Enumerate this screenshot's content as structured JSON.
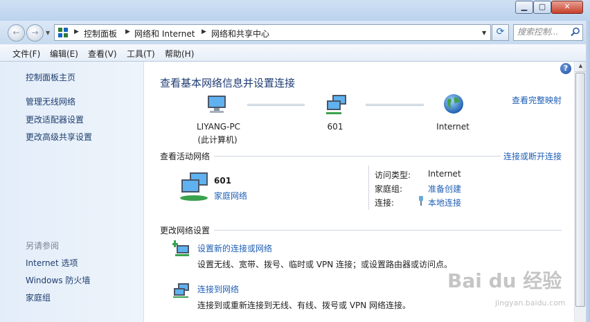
{
  "window": {
    "minimize_glyph": "▁",
    "maximize_glyph": "▢",
    "close_glyph": "✕"
  },
  "nav": {
    "back_glyph": "←",
    "forward_glyph": "→",
    "breadcrumb": [
      "控制面板",
      "网络和 Internet",
      "网络和共享中心"
    ],
    "search_placeholder": "搜索控制...",
    "refresh_glyph": "⟳"
  },
  "menu": [
    "文件(F)",
    "编辑(E)",
    "查看(V)",
    "工具(T)",
    "帮助(H)"
  ],
  "sidebar": {
    "home": "控制面板主页",
    "links": [
      "管理无线网络",
      "更改适配器设置",
      "更改高级共享设置"
    ],
    "see_also_heading": "另请参阅",
    "see_also": [
      "Internet 选项",
      "Windows 防火墙",
      "家庭组"
    ]
  },
  "main": {
    "help_glyph": "?",
    "title": "查看基本网络信息并设置连接",
    "full_map_link": "查看完整映射",
    "map": {
      "computer_name": "LIYANG-PC",
      "computer_sub": "(此计算机)",
      "network": "601",
      "internet": "Internet"
    },
    "active_networks_label": "查看活动网络",
    "connect_disconnect_link": "连接或断开连接",
    "active": {
      "name": "601",
      "type_link": "家庭网络",
      "access_type_label": "访问类型:",
      "access_type_value": "Internet",
      "homegroup_label": "家庭组:",
      "homegroup_value": "准备创建",
      "connection_label": "连接:",
      "connection_value": "本地连接"
    },
    "change_settings_label": "更改网络设置",
    "tasks": [
      {
        "title": "设置新的连接或网络",
        "desc": "设置无线、宽带、拨号、临时或 VPN 连接；或设置路由器或访问点。"
      },
      {
        "title": "连接到网络",
        "desc": "连接到或重新连接到无线、有线、拨号或 VPN 网络连接。"
      }
    ]
  },
  "watermark": {
    "text": "Bai du 经验",
    "sub": "jingyan.baidu.com"
  }
}
